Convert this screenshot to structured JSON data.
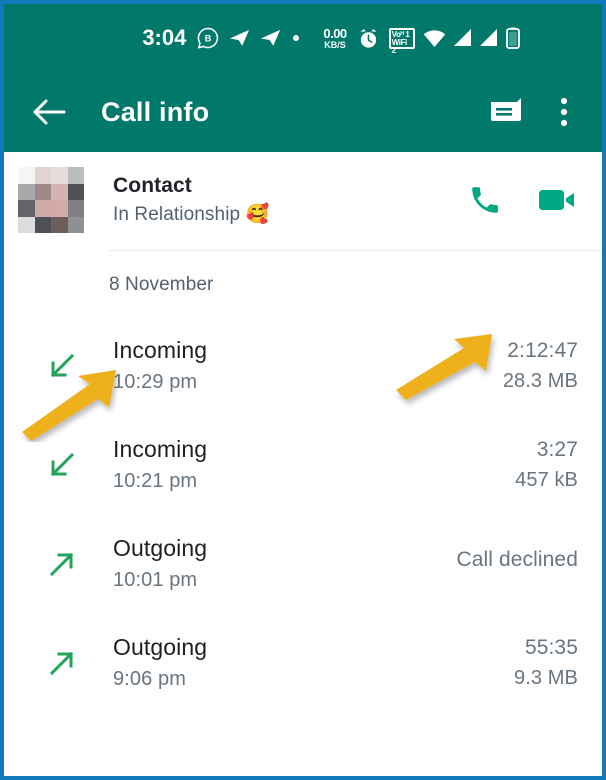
{
  "status_bar": {
    "time": "3:04",
    "network_speed_value": "0.00",
    "network_speed_unit": "KB/S",
    "volte_line1": "Voᴴ 1",
    "volte_line2": "WiFi 2",
    "icons": [
      "whatsapp-business-icon",
      "telegram-icon",
      "telegram-icon",
      "dot-icon",
      "alarm-icon",
      "volte-wifi-icon",
      "wifi-icon",
      "signal-sim1-icon",
      "signal-sim2-icon",
      "battery-icon"
    ]
  },
  "app_bar": {
    "back_label": "back-arrow",
    "title": "Call info",
    "message_action": "message-icon",
    "overflow_action": "more-options-icon"
  },
  "contact": {
    "name": "Contact",
    "status": "In Relationship 🥰",
    "voice_call_label": "voice-call",
    "video_call_label": "video-call"
  },
  "date_header": "8 November",
  "calls": [
    {
      "direction": "incoming",
      "type": "Incoming",
      "time": "10:29 pm",
      "duration": "2:12:47",
      "size": "28.3 MB"
    },
    {
      "direction": "incoming",
      "type": "Incoming",
      "time": "10:21 pm",
      "duration": "3:27",
      "size": "457 kB"
    },
    {
      "direction": "outgoing",
      "type": "Outgoing",
      "time": "10:01 pm",
      "duration": "Call declined",
      "size": ""
    },
    {
      "direction": "outgoing",
      "type": "Outgoing",
      "time": "9:06 pm",
      "duration": "55:35",
      "size": "9.3 MB"
    }
  ],
  "annotations": [
    {
      "name": "arrow-pointing-to-call-time",
      "color": "#eeb11e"
    },
    {
      "name": "arrow-pointing-to-call-duration",
      "color": "#eeb11e"
    }
  ],
  "colors": {
    "header_teal": "#01796a",
    "border_blue": "#1279bd",
    "accent_green": "#25a35a",
    "call_action_green": "#00a884",
    "annotation_yellow": "#eeb11e",
    "primary_text": "#1c2024",
    "secondary_text": "#69757f"
  }
}
